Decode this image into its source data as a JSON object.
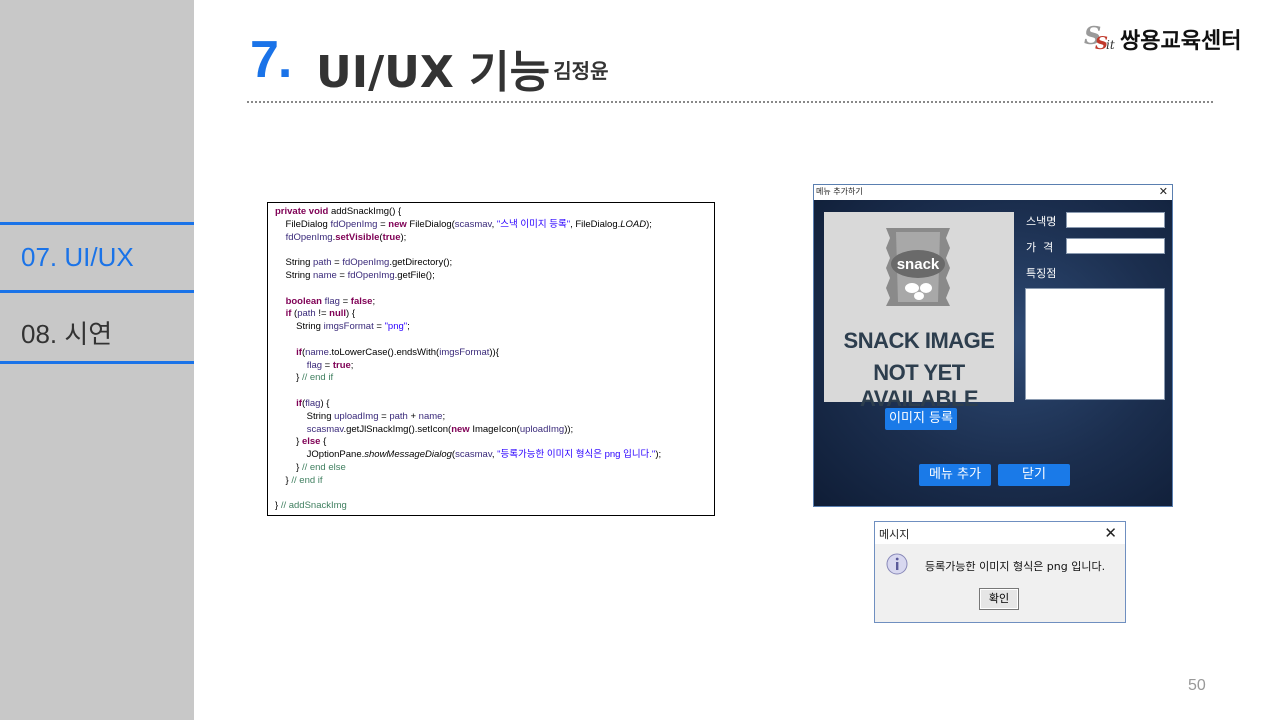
{
  "sidebar": {
    "items": [
      {
        "label": "07. UI/UX",
        "color": "#1a73e8"
      },
      {
        "label": "08. 시연",
        "color": "#333333"
      }
    ]
  },
  "header": {
    "number": "7.",
    "title": "UI/UX 기능",
    "subtitle": "- 김정윤",
    "logo_text": "쌍용교육센터"
  },
  "code": {
    "lines": [
      [
        [
          "kw",
          "private void "
        ],
        [
          "pl",
          "addSnackImg() {"
        ]
      ],
      [
        [
          "pl",
          "    FileDialog "
        ],
        [
          "vr",
          "fdOpenImg"
        ],
        [
          "pl",
          " = "
        ],
        [
          "kw",
          "new "
        ],
        [
          "pl",
          "FileDialog("
        ],
        [
          "vr",
          "scasmav"
        ],
        [
          "pl",
          ", "
        ],
        [
          "st",
          "\"스낵 이미지 등록\""
        ],
        [
          "pl",
          ", FileDialog."
        ],
        [
          "it",
          "LOAD"
        ],
        [
          "pl",
          ");"
        ]
      ],
      [
        [
          "pl",
          "    "
        ],
        [
          "vr",
          "fdOpenImg"
        ],
        [
          "pl",
          "."
        ],
        [
          "kw",
          "setVisible"
        ],
        [
          "pl",
          "("
        ],
        [
          "kw",
          "true"
        ],
        [
          "pl",
          ");"
        ]
      ],
      [
        [
          "pl",
          " "
        ]
      ],
      [
        [
          "pl",
          "    String "
        ],
        [
          "vr",
          "path"
        ],
        [
          "pl",
          " = "
        ],
        [
          "vr",
          "fdOpenImg"
        ],
        [
          "pl",
          ".getDirectory();"
        ]
      ],
      [
        [
          "pl",
          "    String "
        ],
        [
          "vr",
          "name"
        ],
        [
          "pl",
          " = "
        ],
        [
          "vr",
          "fdOpenImg"
        ],
        [
          "pl",
          ".getFile();"
        ]
      ],
      [
        [
          "pl",
          " "
        ]
      ],
      [
        [
          "pl",
          "    "
        ],
        [
          "kw",
          "boolean "
        ],
        [
          "vr",
          "flag"
        ],
        [
          "pl",
          " = "
        ],
        [
          "kw",
          "false"
        ],
        [
          "pl",
          ";"
        ]
      ],
      [
        [
          "pl",
          "    "
        ],
        [
          "kw",
          "if "
        ],
        [
          "pl",
          "("
        ],
        [
          "vr",
          "path"
        ],
        [
          "pl",
          " != "
        ],
        [
          "kw",
          "null"
        ],
        [
          "pl",
          ") {"
        ]
      ],
      [
        [
          "pl",
          "        String "
        ],
        [
          "vr",
          "imgsFormat"
        ],
        [
          "pl",
          " = "
        ],
        [
          "st",
          "\"png\""
        ],
        [
          "pl",
          ";"
        ]
      ],
      [
        [
          "pl",
          " "
        ]
      ],
      [
        [
          "pl",
          "        "
        ],
        [
          "kw",
          "if"
        ],
        [
          "pl",
          "("
        ],
        [
          "vr",
          "name"
        ],
        [
          "pl",
          ".toLowerCase().endsWith("
        ],
        [
          "vr",
          "imgsFormat"
        ],
        [
          "pl",
          "))"
        ],
        [
          "pl",
          "{"
        ]
      ],
      [
        [
          "pl",
          "            "
        ],
        [
          "vr",
          "flag"
        ],
        [
          "pl",
          " = "
        ],
        [
          "kw",
          "true"
        ],
        [
          "pl",
          ";"
        ]
      ],
      [
        [
          "pl",
          "        } "
        ],
        [
          "cm",
          "// end if"
        ]
      ],
      [
        [
          "pl",
          " "
        ]
      ],
      [
        [
          "pl",
          "        "
        ],
        [
          "kw",
          "if"
        ],
        [
          "pl",
          "("
        ],
        [
          "vr",
          "flag"
        ],
        [
          "pl",
          ") {"
        ]
      ],
      [
        [
          "pl",
          "            String "
        ],
        [
          "vr",
          "uploadImg"
        ],
        [
          "pl",
          " = "
        ],
        [
          "vr",
          "path"
        ],
        [
          "pl",
          " + "
        ],
        [
          "vr",
          "name"
        ],
        [
          "pl",
          ";"
        ]
      ],
      [
        [
          "pl",
          "            "
        ],
        [
          "vr",
          "scasmav"
        ],
        [
          "pl",
          ".getJlSnackImg().setIcon("
        ],
        [
          "kw",
          "new "
        ],
        [
          "pl",
          "ImageIcon("
        ],
        [
          "vr",
          "uploadImg"
        ],
        [
          "pl",
          "));"
        ]
      ],
      [
        [
          "pl",
          "        } "
        ],
        [
          "kw",
          "else "
        ],
        [
          "pl",
          "{"
        ]
      ],
      [
        [
          "pl",
          "            JOptionPane."
        ],
        [
          "it",
          "showMessageDialog"
        ],
        [
          "pl",
          "("
        ],
        [
          "vr",
          "scasmav"
        ],
        [
          "pl",
          ", "
        ],
        [
          "st",
          "\"등록가능한 이미지 형식은 png 입니다.\""
        ],
        [
          "pl",
          ");"
        ]
      ],
      [
        [
          "pl",
          "        } "
        ],
        [
          "cm",
          "// end else"
        ]
      ],
      [
        [
          "pl",
          "    } "
        ],
        [
          "cm",
          "// end if"
        ]
      ],
      [
        [
          "pl",
          " "
        ]
      ],
      [
        [
          "pl",
          "} "
        ],
        [
          "cm",
          "// addSnackImg"
        ]
      ]
    ]
  },
  "window": {
    "title": "메뉴 추가하기",
    "close": "✕",
    "snack_logo": "snack",
    "placeholder_line1": "SNACK IMAGE",
    "placeholder_line2": "NOT YET AVAILABLE",
    "label_name": "스낵명",
    "label_price": "가  격",
    "label_feature": "특징점",
    "name_value": "",
    "price_value": "",
    "feature_value": "",
    "register_button": "이미지 등록",
    "add_button": "메뉴 추가",
    "close_button": "닫기"
  },
  "dialog": {
    "title": "메시지",
    "close": "✕",
    "icon": "info-icon",
    "message": "등록가능한 이미지 형식은 png 입니다.",
    "ok_button": "확인"
  },
  "page_number": "50"
}
